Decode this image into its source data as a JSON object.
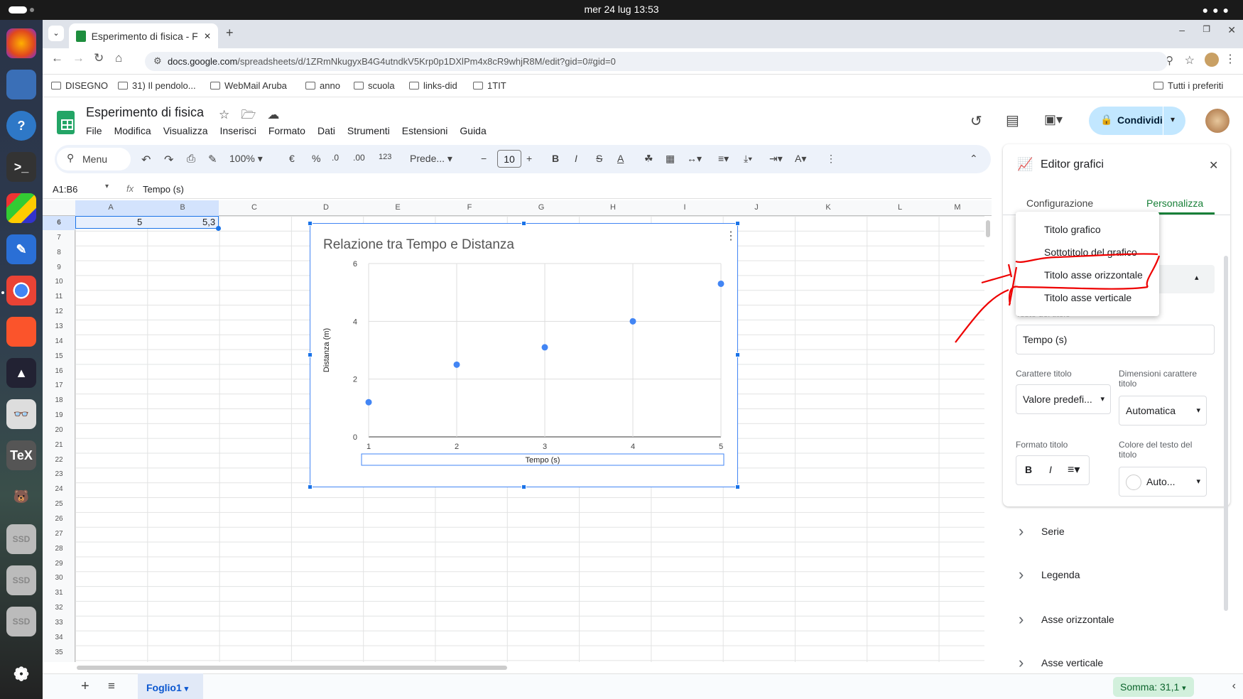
{
  "system": {
    "clock": "mer 24 lug  13:53"
  },
  "browser": {
    "tab_title": "Esperimento di fisica - Fo",
    "url_host": "docs.google.com",
    "url_path": "/spreadsheets/d/1ZRmNkugyxB4G4utndkV5Krp0p1DXlPm4x8cR9whjR8M/edit?gid=0#gid=0",
    "bookmarks": [
      "DISEGNO",
      "31) Il pendolo...",
      "WebMail Aruba",
      "anno",
      "scuola",
      "links-did",
      "1TIT"
    ],
    "all_bookmarks": "Tutti i preferiti"
  },
  "sheet": {
    "title": "Esperimento di fisica",
    "menus": [
      "File",
      "Modifica",
      "Visualizza",
      "Inserisci",
      "Formato",
      "Dati",
      "Strumenti",
      "Estensioni",
      "Guida"
    ],
    "share_label": "Condividi",
    "toolbar": {
      "menu": "Menu",
      "zoom": "100%",
      "currency": "€",
      "percent": "%",
      "dec_minus": ".0",
      "dec_plus": ".00",
      "number_fmt": "123",
      "font": "Prede...",
      "font_size": "10"
    },
    "name_box": "A1:B6",
    "formula": "Tempo (s)",
    "columns": [
      "A",
      "B",
      "C",
      "D",
      "E",
      "F",
      "G",
      "H",
      "I",
      "J",
      "K",
      "L",
      "M"
    ],
    "rows": [
      "6",
      "7",
      "8",
      "9",
      "10",
      "11",
      "12",
      "13",
      "14",
      "15",
      "16",
      "17",
      "18",
      "19",
      "20",
      "21",
      "22",
      "23",
      "24",
      "25",
      "26",
      "27",
      "28",
      "29",
      "30",
      "31",
      "32",
      "33",
      "34",
      "35"
    ],
    "row6": {
      "a": "5",
      "b": "5,3"
    },
    "sheet_tab": "Foglio1",
    "sum": "Somma: 31,1"
  },
  "chart_data": {
    "type": "scatter",
    "title": "Relazione tra Tempo e Distanza",
    "xlabel": "Tempo (s)",
    "ylabel": "Distanza (m)",
    "x": [
      1,
      2,
      3,
      4,
      5
    ],
    "y": [
      1.2,
      2.5,
      3.1,
      4.0,
      5.3
    ],
    "xlim": [
      1,
      5
    ],
    "ylim": [
      0,
      6
    ],
    "x_ticks": [
      "1",
      "2",
      "3",
      "4",
      "5"
    ],
    "y_ticks": [
      "0",
      "2",
      "4",
      "6"
    ],
    "grid": true,
    "color": "#4285f4"
  },
  "panel": {
    "title": "Editor grafici",
    "tabs": [
      "Configurazione",
      "Personalizza"
    ],
    "dropdown_items": [
      "Titolo grafico",
      "Sottotitolo del grafico",
      "Titolo asse orizzontale",
      "Titolo asse verticale"
    ],
    "title_text_label": "Testo del titolo",
    "title_text_value": "Tempo (s)",
    "font_label": "Carattere titolo",
    "font_value": "Valore predefi...",
    "size_label": "Dimensioni carattere titolo",
    "size_value": "Automatica",
    "format_label": "Formato titolo",
    "color_label": "Colore del testo del titolo",
    "color_value": "Auto...",
    "sections": [
      "Serie",
      "Legenda",
      "Asse orizzontale",
      "Asse verticale"
    ]
  }
}
